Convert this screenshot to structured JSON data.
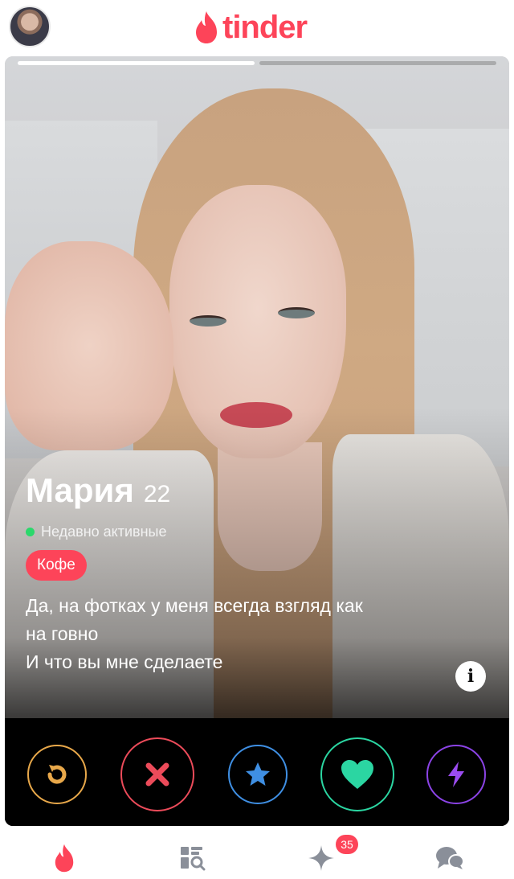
{
  "header": {
    "logo_text": "tinder",
    "brand_color": "#fd4459",
    "avatar_icon": "user-avatar"
  },
  "card": {
    "photo_count": 2,
    "active_photo_index": 1,
    "name": "Мария",
    "age": "22",
    "status_text": "Недавно активные",
    "status_color": "#2bd86b",
    "tag": "Кофе",
    "bio_lines": [
      "Да, на фотках у меня всегда взгляд как",
      "на говно",
      "И что вы мне сделаете"
    ],
    "info_icon": "info-icon"
  },
  "actions": [
    {
      "name": "rewind-button",
      "icon": "rewind-icon",
      "color": "#e8a84a"
    },
    {
      "name": "nope-button",
      "icon": "close-icon",
      "color": "#ec4b5a"
    },
    {
      "name": "super-like-button",
      "icon": "star-icon",
      "color": "#3f8fe3"
    },
    {
      "name": "like-button",
      "icon": "heart-icon",
      "color": "#2bd6a2"
    },
    {
      "name": "boost-button",
      "icon": "lightning-icon",
      "color": "#8b43e6"
    }
  ],
  "bottom_nav": {
    "items": [
      {
        "name": "nav-home",
        "icon": "flame-icon",
        "active": true
      },
      {
        "name": "nav-explore",
        "icon": "explore-icon",
        "active": false
      },
      {
        "name": "nav-likes",
        "icon": "sparkle-icon",
        "active": false,
        "badge": "35"
      },
      {
        "name": "nav-chat",
        "icon": "chat-icon",
        "active": false
      }
    ],
    "likes_badge": "35"
  }
}
